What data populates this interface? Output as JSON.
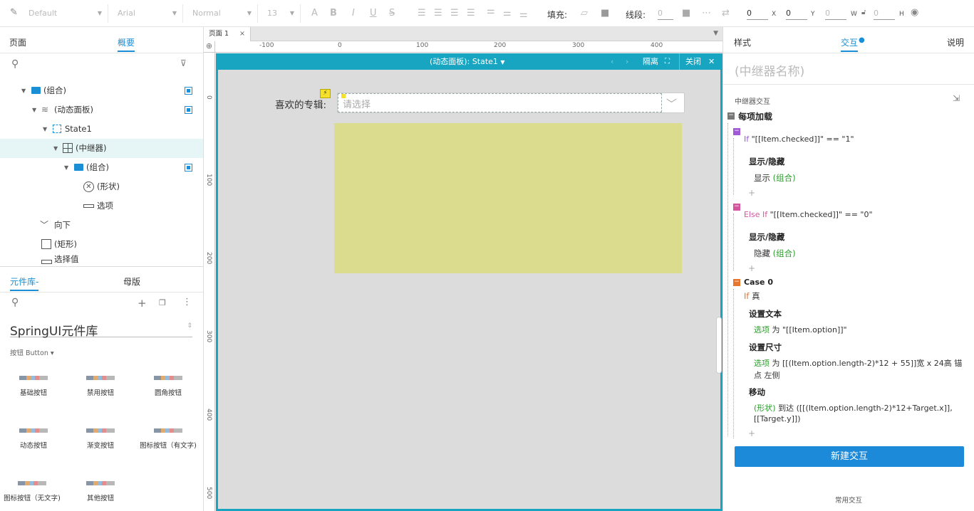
{
  "toolbar": {
    "style_select": "Default",
    "font_select": "Arial",
    "weight_select": "Normal",
    "size_select": "13",
    "fill_label": "填充:",
    "stroke_label": "线段:",
    "stroke_value": "0",
    "x_value": "0",
    "x_unit": "X",
    "y_value": "0",
    "y_unit": "Y",
    "w_value": "0",
    "w_unit": "W",
    "h_value": "0",
    "h_unit": "H"
  },
  "left": {
    "tabs": [
      "页面",
      "概要"
    ],
    "outline": [
      {
        "label": "(组合)"
      },
      {
        "label": "(动态面板)"
      },
      {
        "label": "State1"
      },
      {
        "label": "(中继器)"
      },
      {
        "label": "(组合)"
      },
      {
        "label": "(形状)"
      },
      {
        "label": "选项"
      },
      {
        "label": "向下"
      },
      {
        "label": "(矩形)"
      },
      {
        "label": "选择值"
      }
    ],
    "lib_tabs": [
      "元件库-",
      "母版"
    ],
    "library_name": "SpringUI元件库",
    "category": "按钮 Button ▾",
    "components": [
      "基础按钮",
      "禁用按钮",
      "圆角按钮",
      "动态按钮",
      "渐变按钮",
      "图标按钮（有文字)",
      "图标按钮（无文字)",
      "其他按钮"
    ]
  },
  "canvas": {
    "page_tab": "页面 1",
    "hruler_labels": [
      "-100",
      "0",
      "100",
      "200",
      "300",
      "400"
    ],
    "vruler_labels": [
      "0",
      "100",
      "200",
      "300",
      "400",
      "500"
    ],
    "panel_title": "(动态面板): State1",
    "isolate_label": "隔离",
    "close_label": "关闭",
    "field_label": "喜欢的专辑:",
    "dropdown_placeholder": "请选择"
  },
  "right": {
    "tabs": [
      "样式",
      "交互",
      "说明"
    ],
    "name_placeholder": "(中继器名称)",
    "section_title": "中继器交互",
    "event_title": "每项加载",
    "case1_if": "If",
    "case1_cond": "\"[[Item.checked]]\" == \"1\"",
    "action1_title": "显示/隐藏",
    "action1_verb": "显示",
    "action1_target": "(组合)",
    "case2_if": "Else If",
    "case2_cond": "\"[[Item.checked]]\" == \"0\"",
    "action2_title": "显示/隐藏",
    "action2_verb": "隐藏",
    "action2_target": "(组合)",
    "case3_title": "Case 0",
    "case3_if": "If",
    "case3_cond": "真",
    "action3_title": "设置文本",
    "action3_target": "选项",
    "action3_text": "为 \"[[Item.option]]\"",
    "action4_title": "设置尺寸",
    "action4_target": "选项",
    "action4_text_1": "为 [[(Item.option.length-2)*12 + 55]]宽 x 24高 锚",
    "action4_text_2": "点 左侧",
    "action5_title": "移动",
    "action5_target": "(形状)",
    "action5_text_1": "到达 ([[(Item.option.length-2)*12+Target.x]],",
    "action5_text_2": "[[Target.y]])",
    "plus": "+",
    "new_button": "新建交互",
    "common_label": "常用交互"
  },
  "colors": {
    "accent": "#1a8fd6",
    "panel_header": "#17a5c2",
    "repeater_fill": "#dcdc8e",
    "canvas_bg": "#dcdcdc"
  }
}
